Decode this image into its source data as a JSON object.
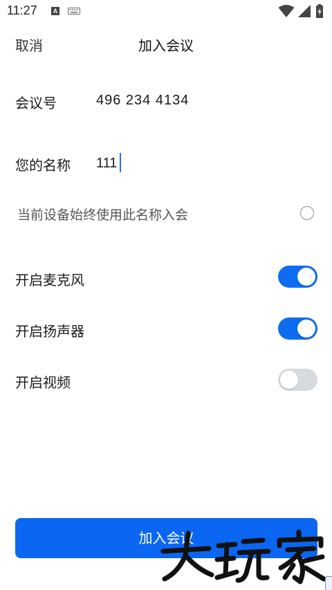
{
  "status_bar": {
    "time": "11:27",
    "icons": [
      "a-icon",
      "keyboard-icon",
      "wifi-icon",
      "signal-icon",
      "battery-icon"
    ]
  },
  "header": {
    "cancel_label": "取消",
    "title": "加入会议"
  },
  "form": {
    "meeting_id_label": "会议号",
    "meeting_id_value": "496 234 4134",
    "name_label": "您的名称",
    "name_value": "111",
    "remember_label": "当前设备始终使用此名称入会",
    "remember_checked": false
  },
  "toggles": [
    {
      "label": "开启麦克风",
      "on": true
    },
    {
      "label": "开启扬声器",
      "on": true
    },
    {
      "label": "开启视频",
      "on": false
    }
  ],
  "join_button_label": "加入会议",
  "watermark_text": "大玩家",
  "colors": {
    "accent": "#0b66f2",
    "toggle_off": "#d6d9dd"
  }
}
